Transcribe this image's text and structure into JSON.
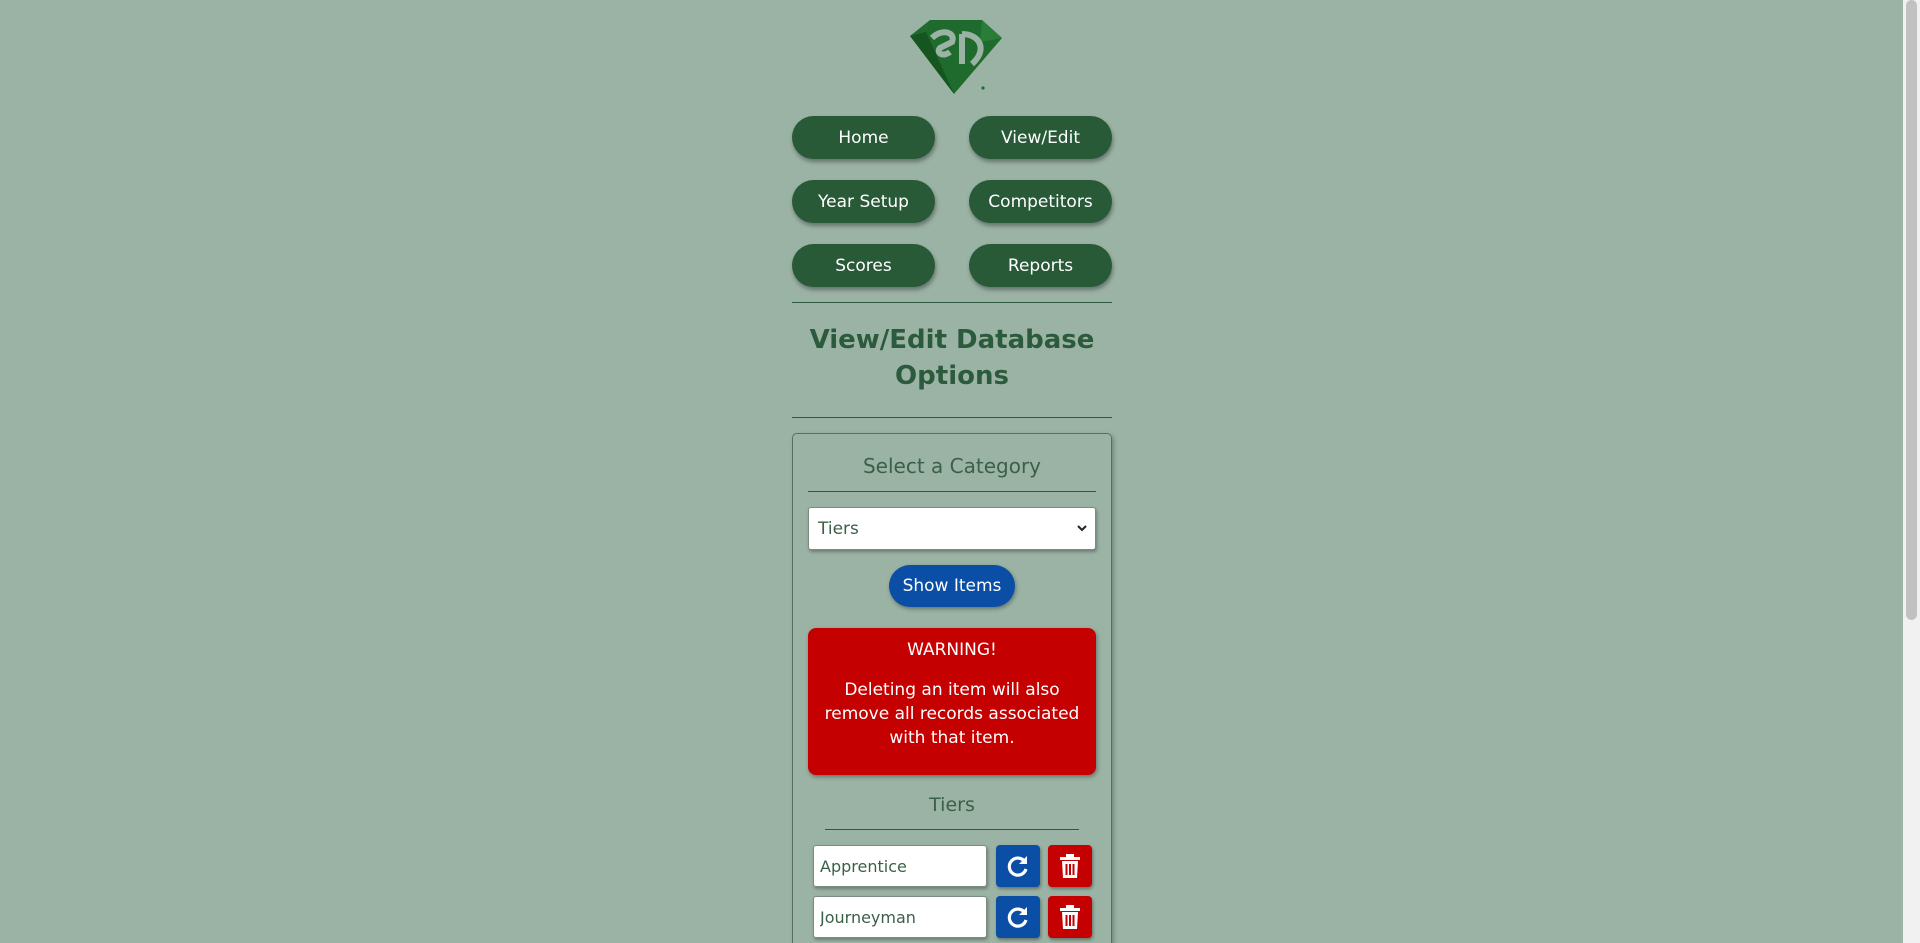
{
  "colors": {
    "page_bg": "#9bb3a5",
    "nav_button": "#285a38",
    "primary_blue": "#0a4ea6",
    "danger_red": "#c40000",
    "heading_green": "#2c5a3c",
    "logo_green": "#1f6b2d"
  },
  "logo": {
    "icon": "sd-diamond-logo"
  },
  "nav": {
    "home": "Home",
    "view_edit": "View/Edit",
    "year_setup": "Year Setup",
    "competitors": "Competitors",
    "scores": "Scores",
    "reports": "Reports"
  },
  "page_title_line1": "View/Edit Database",
  "page_title_line2": "Options",
  "category": {
    "heading": "Select a Category",
    "selected": "Tiers",
    "show_button": "Show Items"
  },
  "warning": {
    "title": "WARNING!",
    "text": "Deleting an item will also remove all records associated with that item."
  },
  "list": {
    "heading": "Tiers",
    "items": [
      {
        "value": "Apprentice",
        "update_icon": "refresh-icon",
        "delete_icon": "trash-icon"
      },
      {
        "value": "Journeyman",
        "update_icon": "refresh-icon",
        "delete_icon": "trash-icon"
      }
    ]
  }
}
